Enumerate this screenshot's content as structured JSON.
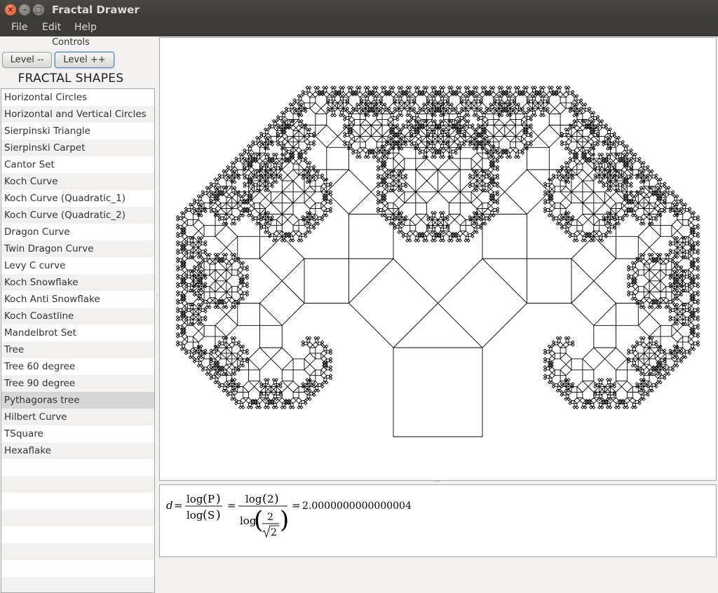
{
  "window": {
    "title": "Fractal Drawer"
  },
  "menu": {
    "file": "File",
    "edit": "Edit",
    "help": "Help"
  },
  "controls": {
    "label": "Controls",
    "level_down": "Level --",
    "level_up": "Level ++"
  },
  "shapes": {
    "title": "FRACTAL SHAPES",
    "items": [
      "Horizontal Circles",
      "Horizontal and Vertical Circles",
      "Sierpinski Triangle",
      "Sierpinski Carpet",
      "Cantor Set",
      "Koch Curve",
      "Koch Curve (Quadratic_1)",
      "Koch Curve (Quadratic_2)",
      "Dragon Curve",
      "Twin Dragon Curve",
      "Levy C curve",
      "Koch Snowflake",
      "Koch Anti Snowflake",
      "Koch Coastline",
      "Mandelbrot Set",
      "Tree",
      "Tree 60 degree",
      "Tree 90 degree",
      "Pythagoras tree",
      "Hilbert Curve",
      "TSquare",
      "Hexaflake"
    ],
    "selected": "Pythagoras tree"
  },
  "canvas": {
    "fractal": "Pythagoras tree",
    "stroke_color": "#000000",
    "background": "#ffffff"
  },
  "formula": {
    "var": "d",
    "eq": "=",
    "num1": "log",
    "arg1": "P",
    "den1": "log",
    "arg2": "S",
    "num2_arg": "2",
    "den2_num": "2",
    "den2_den": "2",
    "result": "2.0000000000000004"
  }
}
